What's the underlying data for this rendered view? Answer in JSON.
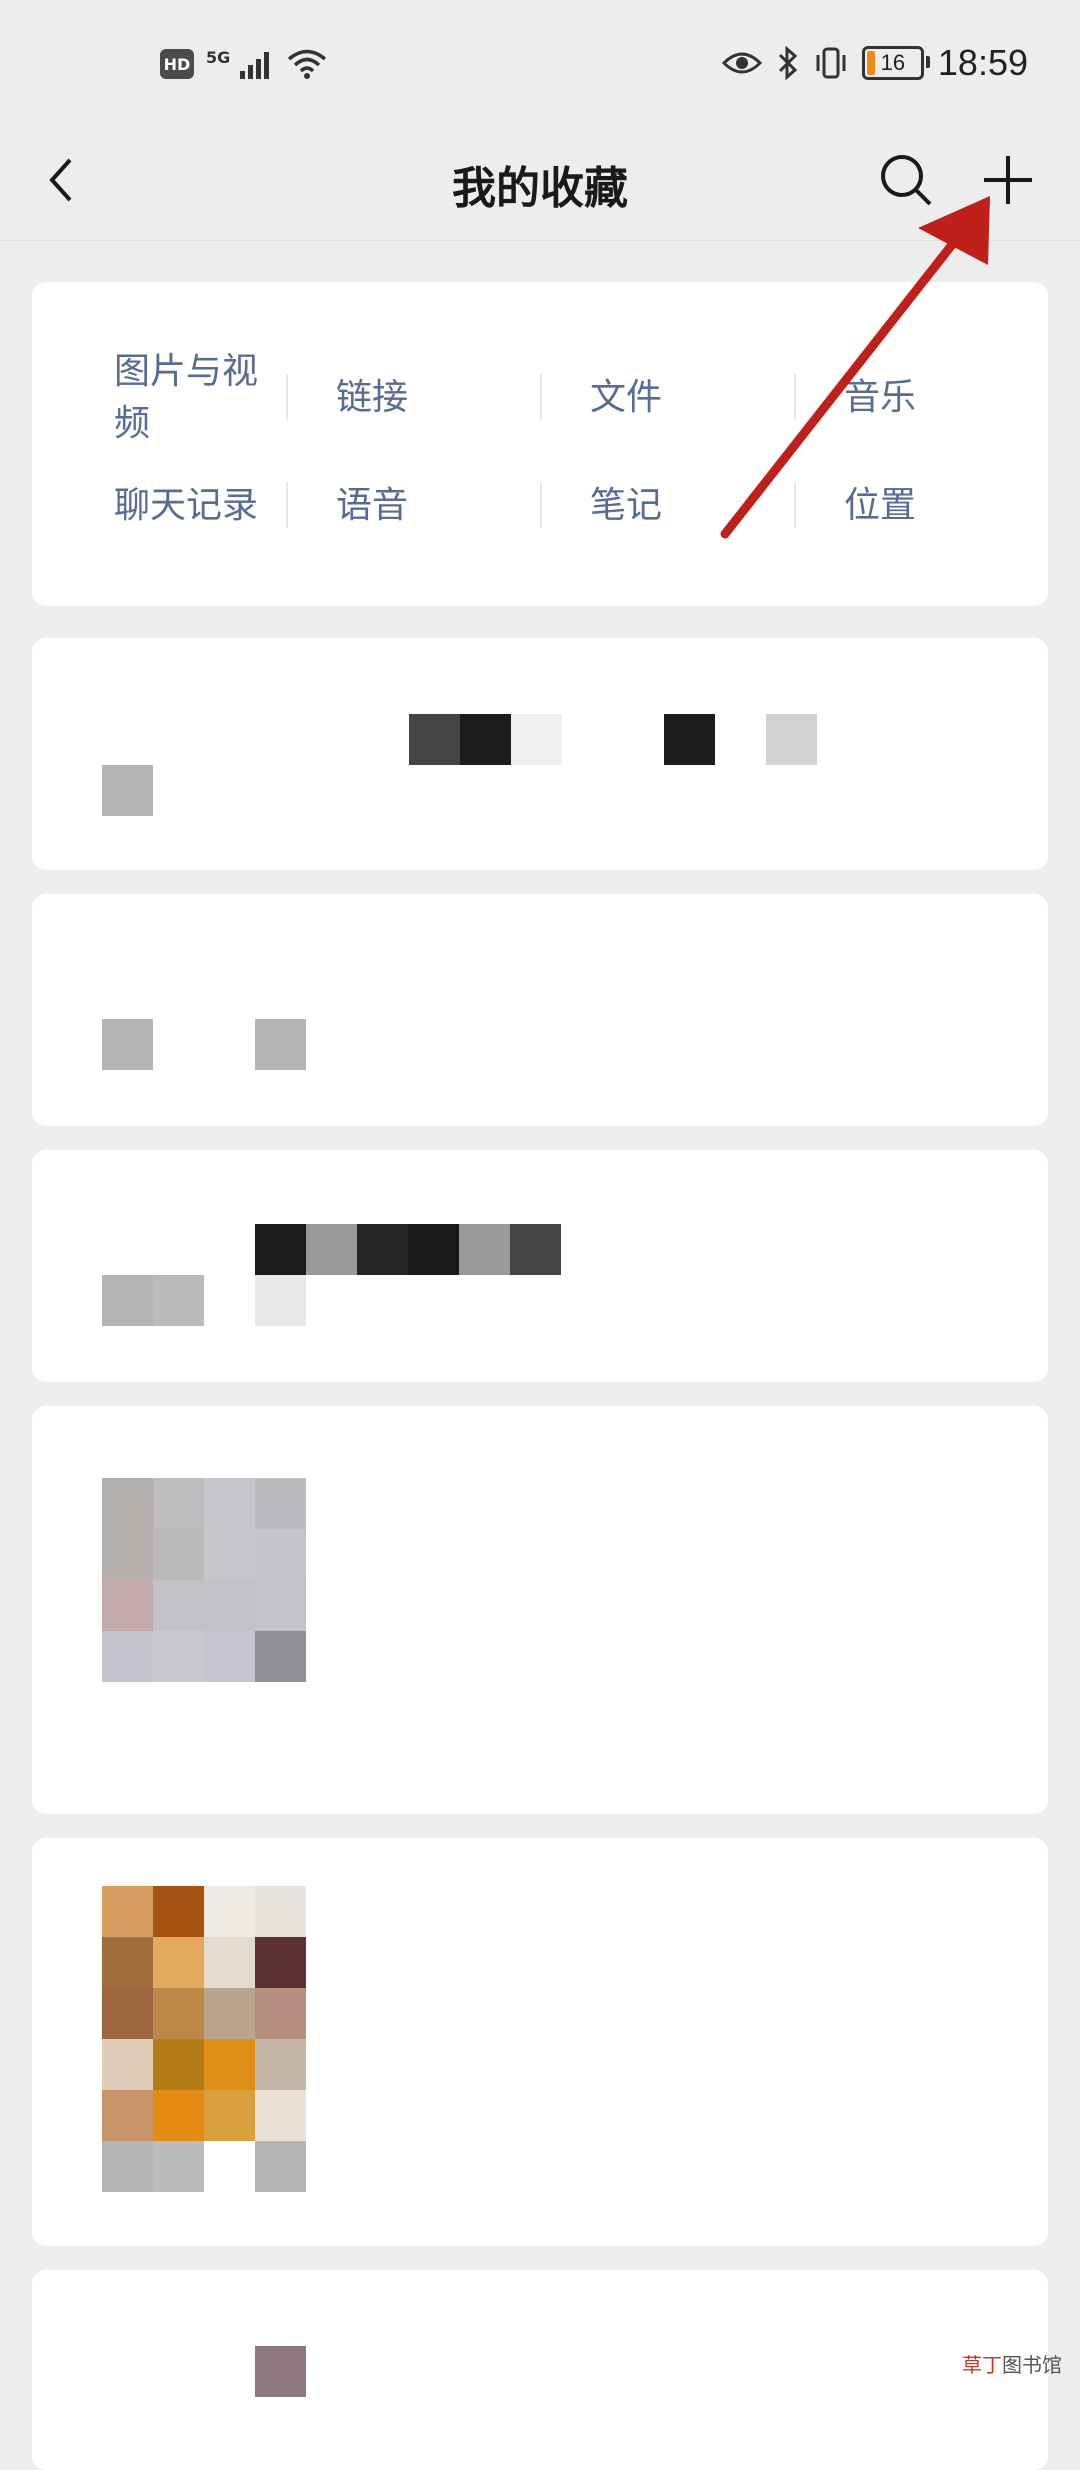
{
  "status_bar": {
    "hd_label": "HD",
    "network": "5G",
    "time": "18:59",
    "battery": "16",
    "icons": [
      "eye-icon",
      "bluetooth-icon",
      "vibrate-icon"
    ]
  },
  "navbar": {
    "title": "我的收藏",
    "icons": [
      "back-icon",
      "search-icon",
      "plus-icon"
    ]
  },
  "categories": [
    [
      "图片与视频",
      "链接",
      "文件",
      "音乐"
    ],
    [
      "聊天记录",
      "语音",
      "笔记",
      "位置"
    ]
  ],
  "annotation": {
    "arrow_color": "#c0201a",
    "target": "plus-icon"
  },
  "watermark": {
    "part1": "草丁",
    "part2": "图书馆"
  },
  "colors": {
    "category_text": "#576b95",
    "background": "#ededed"
  }
}
